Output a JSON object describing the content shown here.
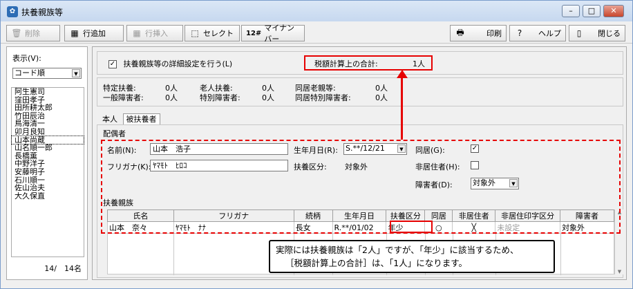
{
  "window": {
    "title": "扶養親族等",
    "min": "–",
    "max": "□",
    "close": "✕"
  },
  "toolbar": {
    "delete": "削除",
    "add_row": "行追加",
    "insert_row": "行挿入",
    "select": "セレクト",
    "mynumber": "マイナンバー",
    "print": "印刷",
    "help": "ヘルプ",
    "close": "閉じる",
    "icons": {
      "mynumber": "12#"
    }
  },
  "left": {
    "display_label": "表示(V):",
    "sort_value": "コード順",
    "names": [
      "阿生憲司",
      "窪田孝子",
      "田所耕太郎",
      "竹田辰治",
      "鳥海清一",
      "卯月良知",
      "山本尚蔵",
      "山名順一郎",
      "長橋薫",
      "中野洋子",
      "安藤明子",
      "石川順一",
      "佐山治夫",
      "大久保直"
    ],
    "count": "14/　14名"
  },
  "detail": {
    "checkbox_label": "扶養親族等の詳細設定を行う(L)",
    "checkbox_checked": "✓",
    "tax_total_label": "税額計算上の合計:",
    "tax_total_value": "1人"
  },
  "summary": {
    "rows": [
      [
        {
          "label": "特定扶養:",
          "value": "0人"
        },
        {
          "label": "老人扶養:",
          "value": "0人"
        },
        {
          "label": "同居老親等:",
          "value": "0人"
        }
      ],
      [
        {
          "label": "一般障害者:",
          "value": "0人"
        },
        {
          "label": "特別障害者:",
          "value": "0人"
        },
        {
          "label": "同居特別障害者:",
          "value": "0人"
        }
      ]
    ]
  },
  "tabs": {
    "self": "本人",
    "dependents": "被扶養者"
  },
  "spouse": {
    "heading": "配偶者",
    "name_label": "名前(N):",
    "name_value": "山本　浩子",
    "kana_label": "フリガナ(K):",
    "kana_value": "ﾔﾏﾓﾄ　ﾋﾛｺ",
    "birth_label": "生年月日(R):",
    "birth_value": "S.**/12/21",
    "dep_type_label": "扶養区分:",
    "dep_type_value": "対象外",
    "cohabit_label": "同居(G):",
    "cohabit_checked": "✓",
    "nonres_label": "非居住者(H):",
    "disabled_label": "障害者(D):",
    "disabled_value": "対象外"
  },
  "dependents": {
    "heading": "扶養親族",
    "columns": [
      "氏名",
      "フリガナ",
      "続柄",
      "生年月日",
      "扶養区分",
      "同居",
      "非居住者",
      "非居住印字区分",
      "障害者"
    ],
    "rows": [
      [
        "山本　奈々",
        "ﾔﾏﾓﾄ　ﾅﾅ",
        "長女",
        "R.**/01/02",
        "年少",
        "○",
        "╳",
        "未設定",
        "対象外"
      ]
    ]
  },
  "note": {
    "line1": "実際には扶養親族は「2人」ですが、「年少」に該当するため、",
    "line2": "［税額計算上の合計］は、「1人」になります。"
  },
  "colors": {
    "highlight": "#e60000",
    "title_bg": "#c6d8ef"
  }
}
